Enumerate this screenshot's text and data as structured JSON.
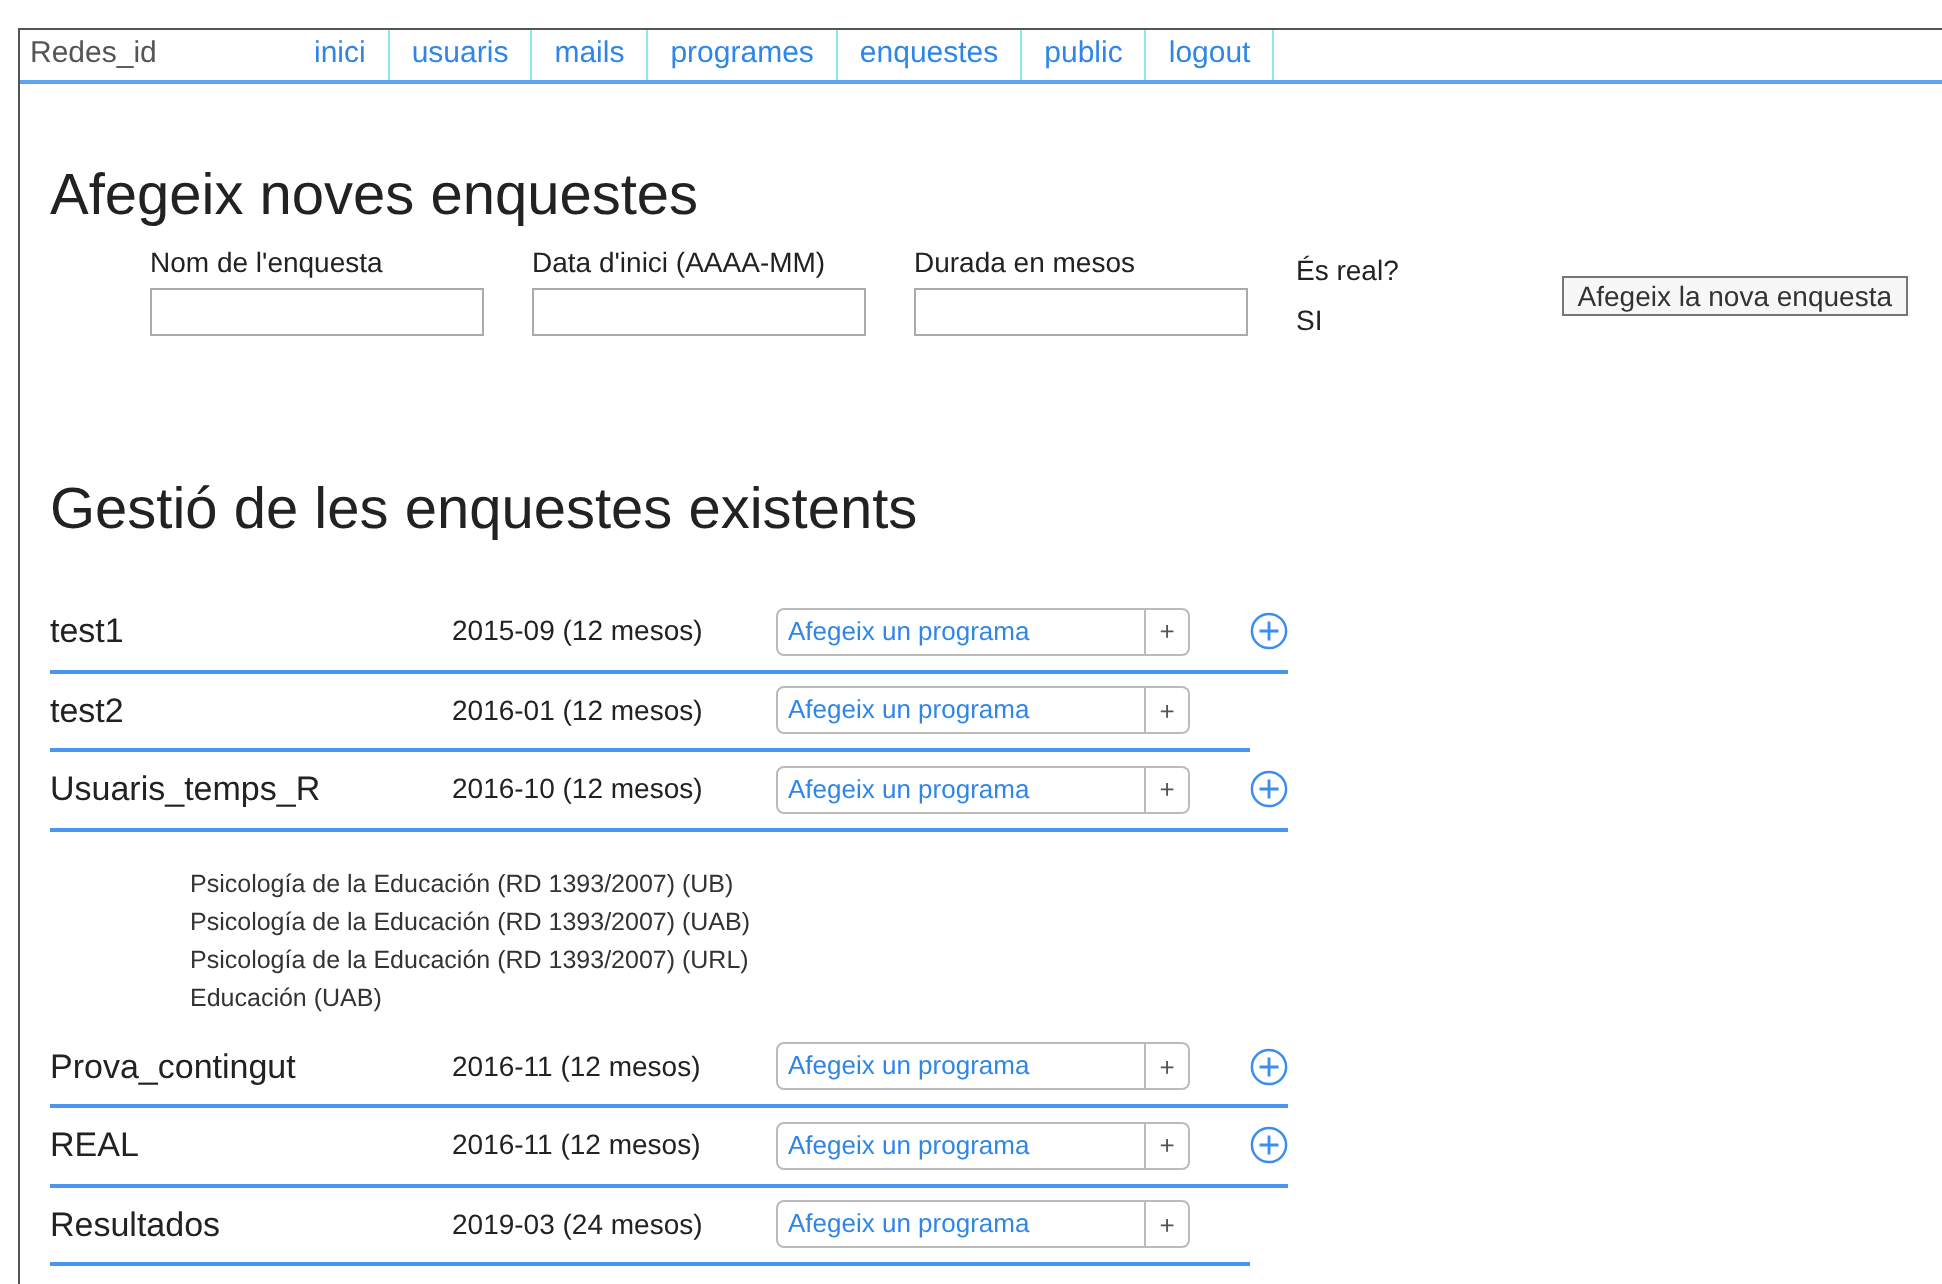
{
  "brand": "Redes_id",
  "nav": [
    {
      "label": "inici"
    },
    {
      "label": "usuaris"
    },
    {
      "label": "mails"
    },
    {
      "label": "programes"
    },
    {
      "label": "enquestes"
    },
    {
      "label": "public"
    },
    {
      "label": "logout"
    }
  ],
  "new_survey": {
    "title": "Afegeix noves enquestes",
    "fields": [
      {
        "label": "Nom de l'enquesta"
      },
      {
        "label": "Data d'inici (AAAA-MM)"
      },
      {
        "label": "Durada en mesos"
      }
    ],
    "real_label": "És real?",
    "real_value": "SI",
    "submit": "Afegeix la nova enquesta"
  },
  "existing": {
    "title": "Gestió de les enquestes existents",
    "surveys": [
      {
        "name": "test1",
        "period": "2015-09 (12 mesos)",
        "select": "Afegeix un programa",
        "add": "+",
        "expandable": true
      },
      {
        "name": "test2",
        "period": "2016-01 (12 mesos)",
        "select": "Afegeix un programa",
        "add": "+",
        "expandable": false
      },
      {
        "name": "Usuaris_temps_R",
        "period": "2016-10 (12 mesos)",
        "select": "Afegeix un programa",
        "add": "+",
        "expandable": true,
        "programs": [
          "Psicología de la Educación (RD 1393/2007) (UB)",
          "Psicología de la Educación (RD 1393/2007) (UAB)",
          "Psicología de la Educación (RD 1393/2007) (URL)",
          "Educación (UAB)"
        ]
      },
      {
        "name": "Prova_contingut",
        "period": "2016-11 (12 mesos)",
        "select": "Afegeix un programa",
        "add": "+",
        "expandable": true
      },
      {
        "name": "REAL",
        "period": "2016-11 (12 mesos)",
        "select": "Afegeix un programa",
        "add": "+",
        "expandable": true
      },
      {
        "name": "Resultados",
        "period": "2019-03 (24 mesos)",
        "select": "Afegeix un programa",
        "add": "+",
        "expandable": false
      }
    ]
  }
}
